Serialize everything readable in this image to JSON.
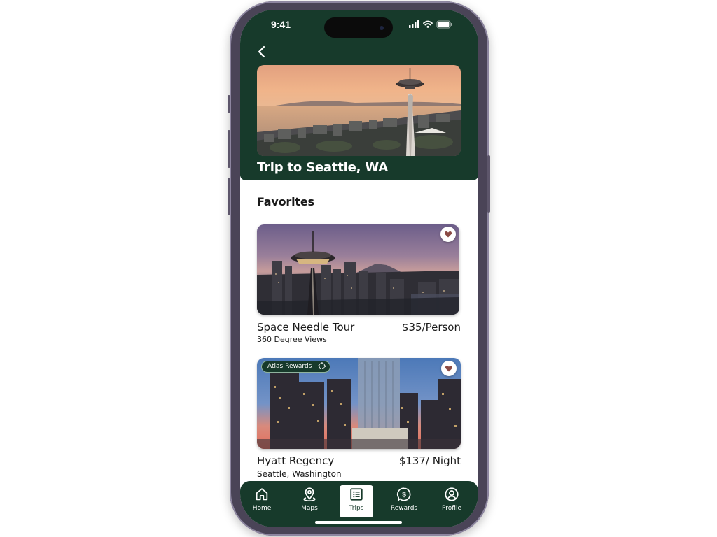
{
  "status_bar": {
    "time": "9:41"
  },
  "trip": {
    "title": "Trip to Seattle, WA"
  },
  "favorites": {
    "heading": "Favorites",
    "items": [
      {
        "name": "Space Needle Tour",
        "price": "$35/Person",
        "subtitle": "360 Degree Views",
        "favorited": true
      },
      {
        "name": "Hyatt Regency",
        "price": "$137/ Night",
        "subtitle": "Seattle, Washington",
        "badge": "Atlas Rewards",
        "favorited": true
      }
    ]
  },
  "tabs": [
    {
      "label": "Home",
      "icon": "home-icon",
      "active": false
    },
    {
      "label": "Maps",
      "icon": "map-pin-icon",
      "active": false
    },
    {
      "label": "Trips",
      "icon": "list-icon",
      "active": true
    },
    {
      "label": "Rewards",
      "icon": "dollar-badge-icon",
      "active": false
    },
    {
      "label": "Profile",
      "icon": "user-circle-icon",
      "active": false
    }
  ],
  "colors": {
    "header_green": "#173a2b",
    "heart": "#8a4a44",
    "text": "#1a1a1a"
  }
}
